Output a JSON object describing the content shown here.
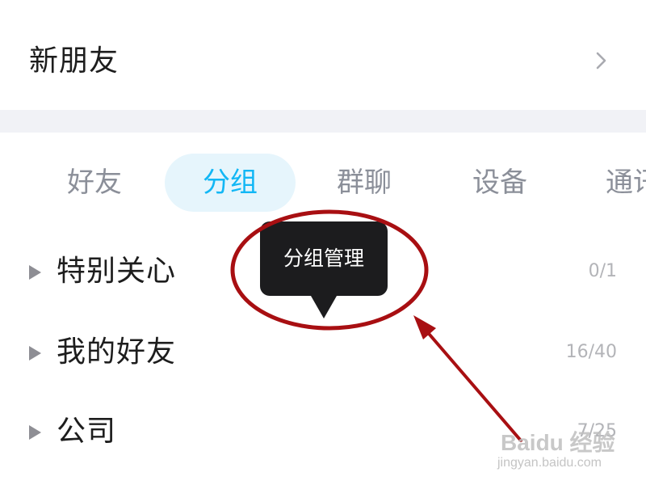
{
  "new_friends": {
    "title": "新朋友"
  },
  "tabs": [
    {
      "label": "好友",
      "active": false
    },
    {
      "label": "分组",
      "active": true
    },
    {
      "label": "群聊",
      "active": false
    },
    {
      "label": "设备",
      "active": false
    },
    {
      "label": "通讯",
      "active": false
    }
  ],
  "groups": [
    {
      "name": "特别关心",
      "count": "0/1"
    },
    {
      "name": "我的好友",
      "count": "16/40"
    },
    {
      "name": "公司",
      "count": "7/25"
    }
  ],
  "tooltip": {
    "label": "分组管理"
  },
  "watermark": {
    "logo": "Baidu 经验",
    "url": "jingyan.baidu.com"
  },
  "colors": {
    "accent": "#12b7f5",
    "active_tab_bg": "#e6f5fc",
    "inactive_tab_text": "#8b8f99",
    "separator": "#f1f2f6",
    "tooltip_bg": "#1c1c1e",
    "annotation_red": "#a80f12"
  },
  "icons": {
    "chevron": "chevron-right-icon",
    "expand": "triangle-right-icon",
    "annotation": "red-circle-and-arrow"
  }
}
